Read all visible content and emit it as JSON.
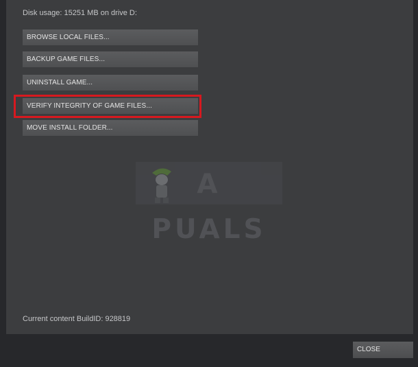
{
  "disk_usage": "Disk usage: 15251 MB on drive D:",
  "buttons": [
    {
      "label": "BROWSE LOCAL FILES..."
    },
    {
      "label": "BACKUP GAME FILES..."
    },
    {
      "label": "UNINSTALL GAME..."
    },
    {
      "label": "VERIFY INTEGRITY OF GAME FILES..."
    },
    {
      "label": "MOVE INSTALL FOLDER..."
    }
  ],
  "watermark": {
    "text": "A PUALS",
    "icon": "appuals-mascot-icon"
  },
  "build_id": "Current content BuildID: 928819",
  "close_label": "CLOSE",
  "colors": {
    "highlight": "#d7191f",
    "panel": "#3c3d3f",
    "background": "#27282b",
    "button": "#55565a"
  }
}
